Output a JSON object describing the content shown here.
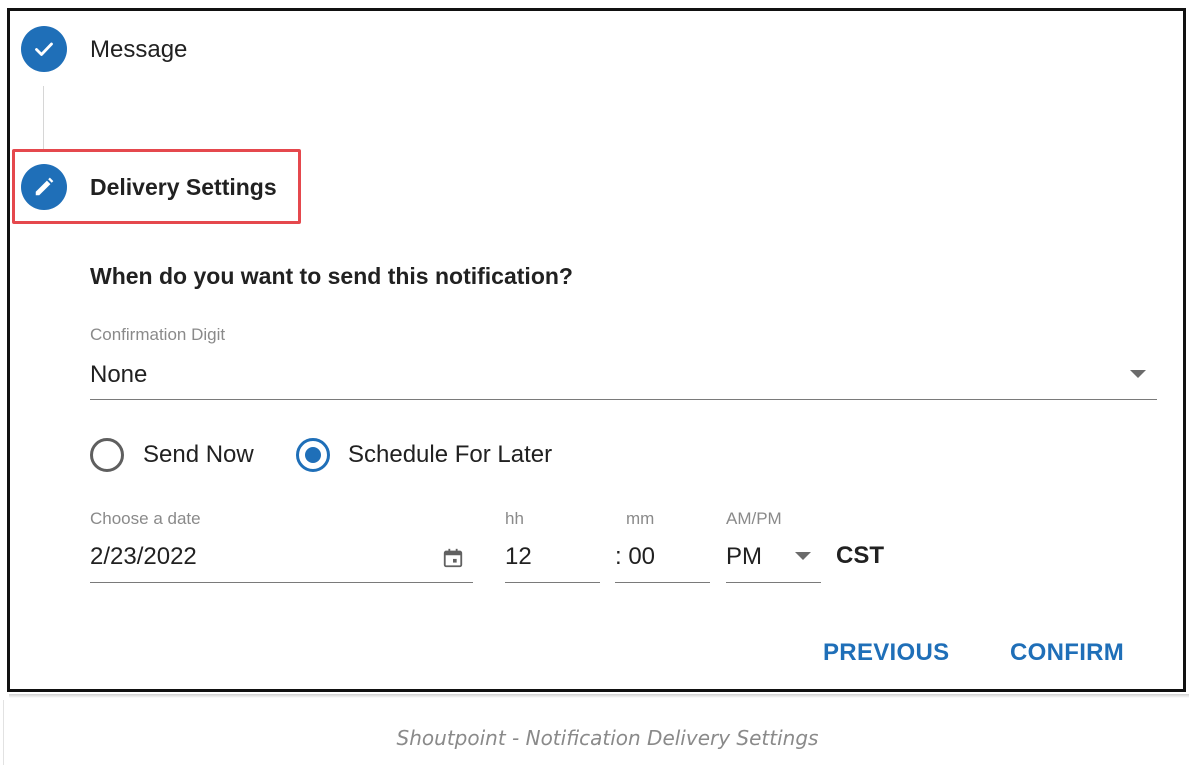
{
  "steps": [
    {
      "label": "Message",
      "status": "complete",
      "icon": "check-icon"
    },
    {
      "label": "Delivery Settings",
      "status": "active",
      "icon": "pencil-icon"
    }
  ],
  "form": {
    "question": "When do you want to send this notification?",
    "confirmation_digit": {
      "label": "Confirmation Digit",
      "value": "None"
    },
    "send_options": [
      {
        "label": "Send Now",
        "selected": false
      },
      {
        "label": "Schedule For Later",
        "selected": true
      }
    ],
    "date": {
      "label": "Choose a date",
      "value": "2/23/2022",
      "icon": "calendar-icon"
    },
    "hour": {
      "label": "hh",
      "value": "12"
    },
    "minute": {
      "label": "mm",
      "value": ": 00"
    },
    "ampm": {
      "label": "AM/PM",
      "value": "PM"
    },
    "timezone": "CST"
  },
  "buttons": {
    "previous": "PREVIOUS",
    "confirm": "CONFIRM"
  },
  "caption": "Shoutpoint - Notification Delivery Settings",
  "colors": {
    "primary": "#1f6fb8",
    "highlight": "#e5484d"
  }
}
